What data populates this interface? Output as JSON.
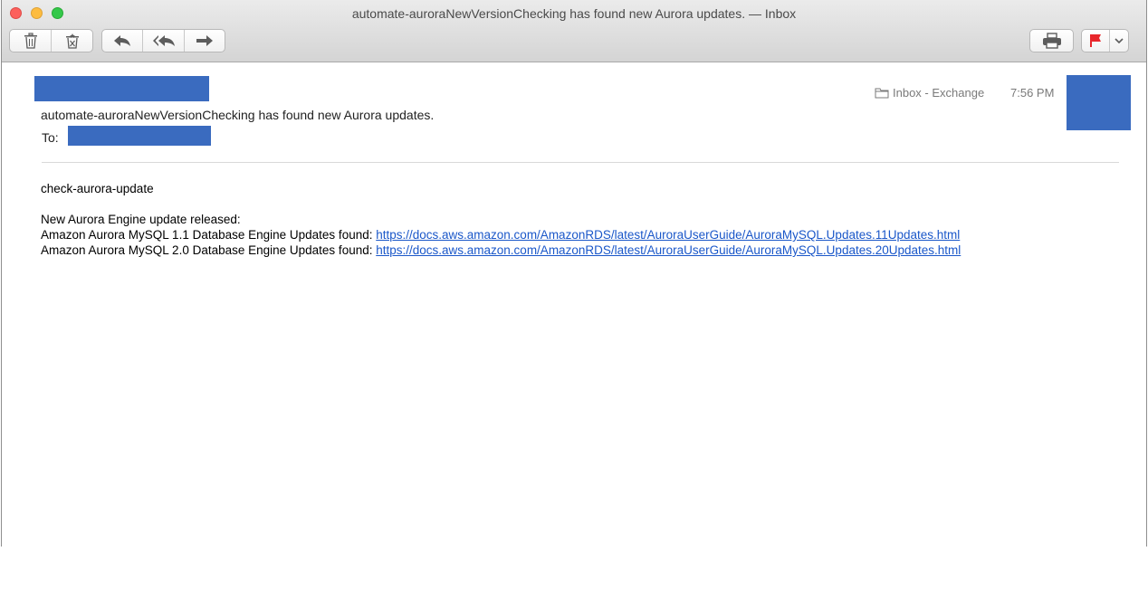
{
  "window": {
    "title": "automate-auroraNewVersionChecking has found new Aurora updates. — Inbox"
  },
  "toolbar": {
    "buttons": [
      {
        "name": "delete",
        "icon": "trash-icon"
      },
      {
        "name": "junk",
        "icon": "junk-icon"
      },
      {
        "name": "reply",
        "icon": "reply-icon"
      },
      {
        "name": "reply-all",
        "icon": "reply-all-icon"
      },
      {
        "name": "forward",
        "icon": "forward-icon"
      },
      {
        "name": "print",
        "icon": "printer-icon"
      },
      {
        "name": "flag",
        "icon": "flag-icon"
      },
      {
        "name": "flag-menu",
        "icon": "chevron-down-icon"
      }
    ],
    "flag_color": "#e8262b"
  },
  "message": {
    "subject": "automate-auroraNewVersionChecking has found new Aurora updates.",
    "to_label": "To:",
    "mailbox": "Inbox - Exchange",
    "time": "7:56 PM",
    "redaction_color": "#3a6bbf",
    "body": {
      "line1": "check-aurora-update",
      "line2": "New Aurora Engine update released:",
      "update1_text": "Amazon Aurora MySQL 1.1 Database Engine Updates found: ",
      "update1_link": "https://docs.aws.amazon.com/AmazonRDS/latest/AuroraUserGuide/AuroraMySQL.Updates.11Updates.html",
      "update2_text": "Amazon Aurora MySQL 2.0 Database Engine Updates found: ",
      "update2_link": "https://docs.aws.amazon.com/AmazonRDS/latest/AuroraUserGuide/AuroraMySQL.Updates.20Updates.html"
    }
  }
}
